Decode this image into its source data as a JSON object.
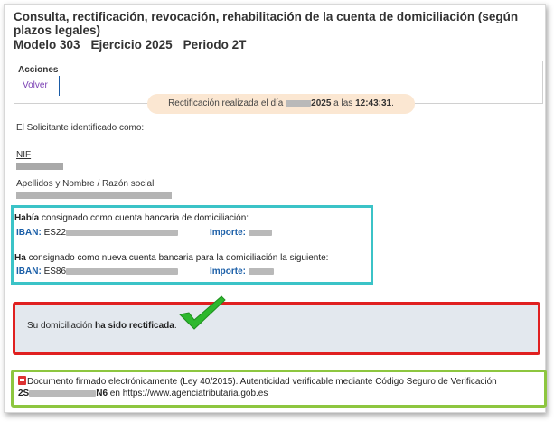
{
  "header": {
    "title": "Consulta, rectificación, revocación, rehabilitación de la cuenta de domiciliación (según plazos legales)",
    "modelo": "Modelo 303",
    "ejercicio": "Ejercicio 2025",
    "periodo": "Periodo 2T"
  },
  "acciones": {
    "label": "Acciones",
    "volver": "Volver"
  },
  "banner": {
    "prefix": "Rectificación realizada el día ",
    "year": "2025",
    "middle": " a las ",
    "time": "12:43:31",
    "suffix": "."
  },
  "solicitante": {
    "intro": "El Solicitante identificado como:",
    "nif_label": "NIF",
    "apellidos_label": "Apellidos y Nombre / Razón social"
  },
  "cuentas": {
    "anterior_bold": "Había",
    "anterior_rest": " consignado como cuenta bancaria de domiciliación:",
    "nueva_bold": "Ha",
    "nueva_rest": " consignado como nueva cuenta bancaria para la domiciliación la siguiente:",
    "iban_label": "IBAN:",
    "iban_anterior_prefix": "ES22",
    "iban_nueva_prefix": "ES86",
    "importe_label": "Importe:"
  },
  "resultado": {
    "prefix": "Su domiciliación ",
    "bold": "ha sido rectificada",
    "suffix": "."
  },
  "documento": {
    "line1": "Documento firmado electrónicamente (Ley 40/2015). Autenticidad verificable mediante Código Seguro de Verificación",
    "csv_start": "2S",
    "csv_end": "N6",
    "line2_rest": " en https://www.agenciatributaria.gob.es"
  },
  "colors": {
    "iban_box": "#3bc3c7",
    "success_border": "#e02020",
    "doc_border": "#8dc63f",
    "checkmark": "#2db82d",
    "banner_bg": "#fbe7d2",
    "label_blue": "#1b5fa8"
  }
}
